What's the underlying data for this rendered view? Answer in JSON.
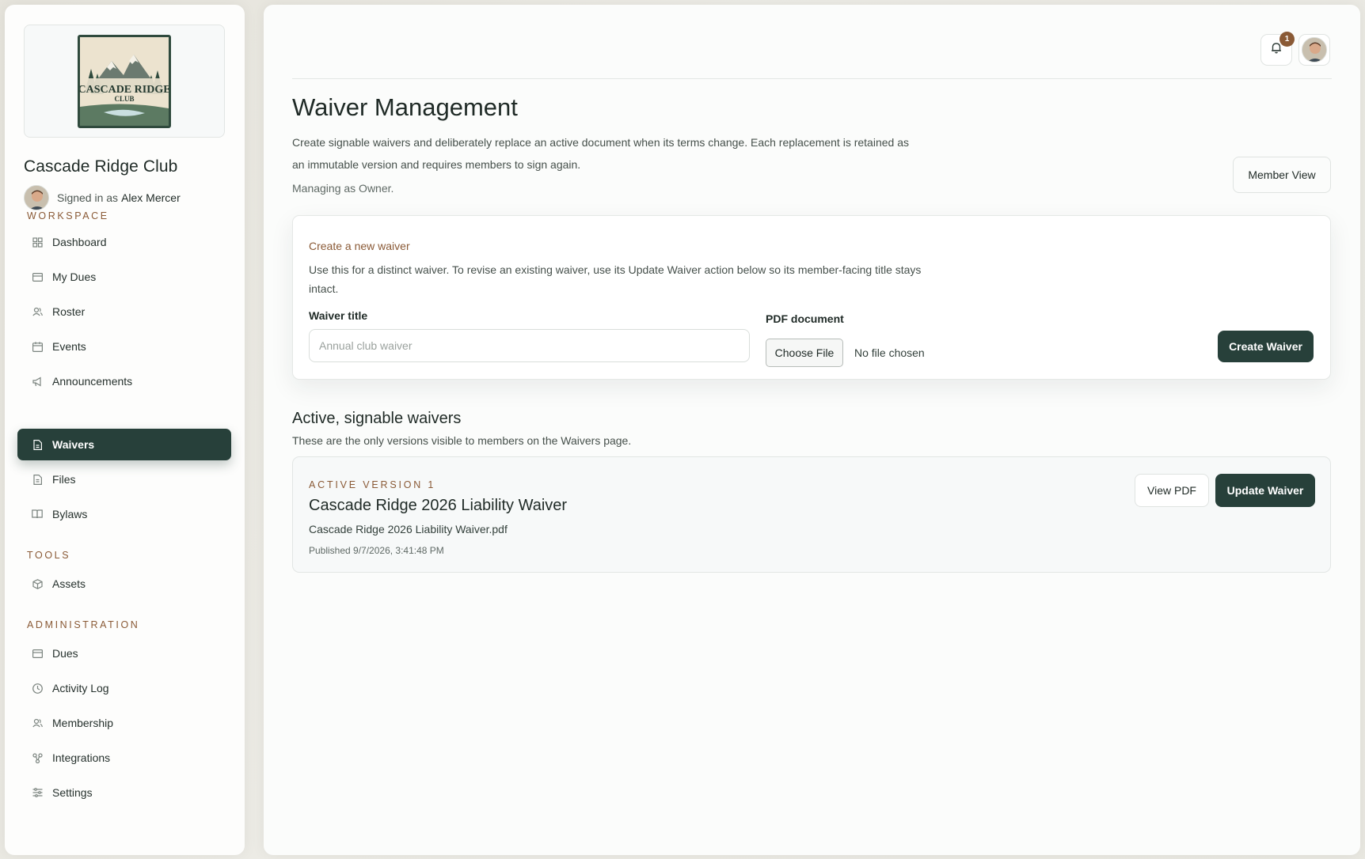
{
  "sidebar": {
    "club_name": "Cascade Ridge Club",
    "logo_text": [
      "CASCADE RIDGE",
      "CLUB"
    ],
    "signed_in_prefix": "Signed in as",
    "user_name": "Alex Mercer",
    "sections": {
      "workspace": "WORKSPACE",
      "tools": "TOOLS",
      "administration": "ADMINISTRATION"
    },
    "workspace_items": [
      {
        "label": "Dashboard",
        "icon": "grid-icon"
      },
      {
        "label": "My Dues",
        "icon": "card-icon"
      },
      {
        "label": "Roster",
        "icon": "users-icon"
      },
      {
        "label": "Events",
        "icon": "calendar-icon"
      },
      {
        "label": "Announcements",
        "icon": "megaphone-icon"
      },
      {
        "label": "Waivers",
        "icon": "document-icon",
        "active": true
      },
      {
        "label": "Files",
        "icon": "file-icon"
      },
      {
        "label": "Bylaws",
        "icon": "book-icon"
      }
    ],
    "tools_items": [
      {
        "label": "Assets",
        "icon": "cube-icon"
      }
    ],
    "admin_items": [
      {
        "label": "Dues",
        "icon": "card-icon"
      },
      {
        "label": "Activity Log",
        "icon": "clock-icon"
      },
      {
        "label": "Membership",
        "icon": "users-icon"
      },
      {
        "label": "Integrations",
        "icon": "nodes-icon"
      },
      {
        "label": "Settings",
        "icon": "sliders-icon"
      }
    ]
  },
  "header": {
    "notification_count": "1"
  },
  "main": {
    "title": "Waiver Management",
    "description": "Create signable waivers and deliberately replace an active document when its terms change. Each replacement is retained as an immutable version and requires members to sign again.",
    "managing": "Managing as Owner.",
    "member_view_label": "Member View"
  },
  "create_card": {
    "title": "Create a new waiver",
    "description": "Use this for a distinct waiver. To revise an existing waiver, use its Update Waiver action below so its member-facing title stays intact.",
    "waiver_title_label": "Waiver title",
    "waiver_title_placeholder": "Annual club waiver",
    "waiver_title_value": "",
    "pdf_label": "PDF document",
    "choose_file_label": "Choose File",
    "no_file_text": "No file chosen",
    "create_button": "Create Waiver"
  },
  "active_waivers": {
    "title": "Active, signable waivers",
    "subtitle": "These are the only versions visible to members on the Waivers page.",
    "items": [
      {
        "version_label": "ACTIVE VERSION 1",
        "name": "Cascade Ridge 2026 Liability Waiver",
        "file": "Cascade Ridge 2026 Liability Waiver.pdf",
        "published": "Published 9/7/2026, 3:41:48 PM",
        "view_label": "View PDF",
        "update_label": "Update Waiver"
      }
    ]
  },
  "colors": {
    "accent_dark": "#27403a",
    "accent_brown": "#8a5a36"
  }
}
